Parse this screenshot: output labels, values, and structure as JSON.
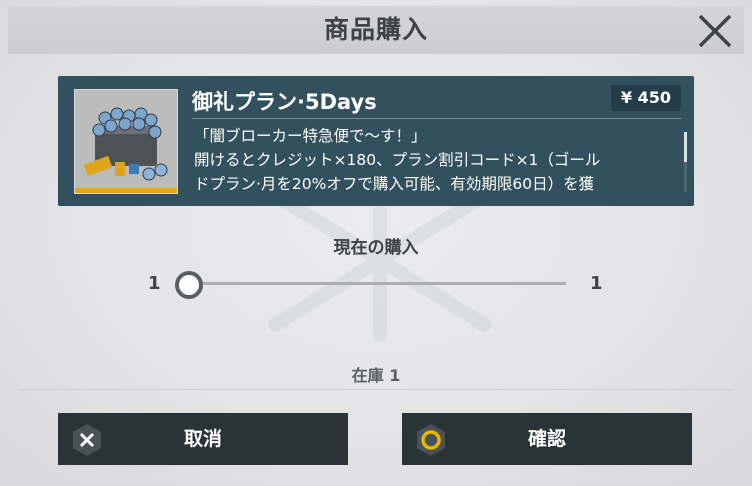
{
  "dialog": {
    "title": "商品購入",
    "close_icon": "close-icon"
  },
  "product": {
    "name": "御礼プラン·5Days",
    "price": "¥ 450",
    "description_lines": [
      "「闇ブローカー特急便で～す！」",
      "開けるとクレジット×180、プラン割引コード×1（ゴール",
      "ドプラン·月を20%オフで購入可能、有効期限60日）を獲"
    ],
    "thumbnail_icon": "supply-crate-icon"
  },
  "quantity": {
    "label": "現在の購入",
    "min": "1",
    "max": "1",
    "value_fraction": 0
  },
  "stock": {
    "label": "在庫 1"
  },
  "buttons": {
    "cancel": {
      "label": "取消",
      "icon": "x-icon"
    },
    "confirm": {
      "label": "確認",
      "icon": "circle-icon"
    }
  },
  "colors": {
    "card": "#33505f",
    "button": "#2a3337",
    "confirm_accent": "#e6b800",
    "thumb_bar": "#e7a41e"
  }
}
